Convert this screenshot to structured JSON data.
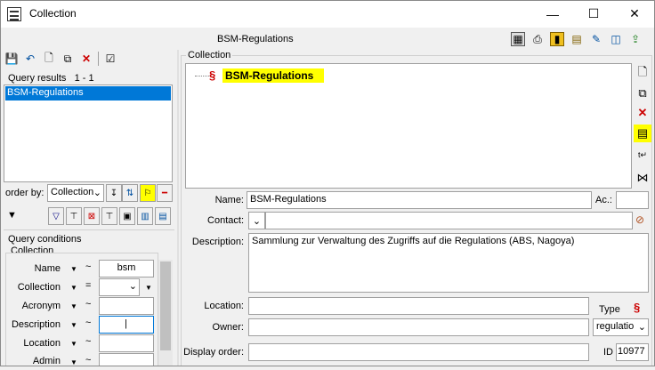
{
  "window": {
    "title": "Collection",
    "minimize": "—",
    "maximize": "☐",
    "close": "✕"
  },
  "header": {
    "title": "BSM-Regulations"
  },
  "left": {
    "query_results_label": "Query results",
    "query_results_count": "1 - 1",
    "results": [
      "BSM-Regulations"
    ],
    "order_by_label": "order by:",
    "order_by_value": "Collection",
    "query_conditions_label": "Query conditions",
    "collection_group_label": "Collection",
    "conditions": [
      {
        "label": "Name",
        "op": "~",
        "value": "bsm"
      },
      {
        "label": "Collection",
        "op": "=",
        "value": ""
      },
      {
        "label": "Acronym",
        "op": "~",
        "value": ""
      },
      {
        "label": "Description",
        "op": "~",
        "value": "|"
      },
      {
        "label": "Location",
        "op": "~",
        "value": ""
      },
      {
        "label": "Admin",
        "op": "~",
        "value": ""
      }
    ]
  },
  "right": {
    "group_label": "Collection",
    "tree_root_symbol": "§",
    "tree_root_label": "BSM-Regulations",
    "name_label": "Name:",
    "name_value": "BSM-Regulations",
    "ac_label": "Ac.:",
    "ac_value": "",
    "contact_label": "Contact:",
    "contact_value": "",
    "description_label": "Description:",
    "description_value": "Sammlung zur Verwaltung des Zugriffs auf die Regulations (ABS, Nagoya)",
    "location_label": "Location:",
    "location_value": "",
    "type_label": "Type",
    "type_symbol": "§",
    "owner_label": "Owner:",
    "owner_value": "",
    "type_select_value": "regulatio",
    "display_order_label": "Display order:",
    "display_order_value": "",
    "id_label": "ID",
    "id_value": "10977"
  },
  "colors": {
    "selection": "#0078d7",
    "highlight": "#ffff00",
    "regulation_red": "#cc0000"
  }
}
